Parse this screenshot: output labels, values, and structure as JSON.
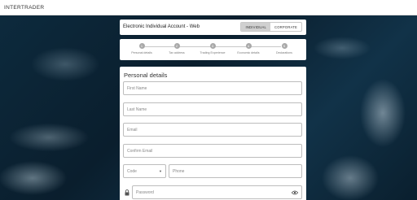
{
  "header": {
    "logo_text": "INTERTRADER"
  },
  "account_card": {
    "title": "Electronic Individual Account - Web",
    "toggle": {
      "individual": "INDIVIDUAL",
      "corporate": "CORPORATE",
      "selected": "INDIVIDUAL"
    }
  },
  "steps": [
    {
      "number": "1",
      "label": "Personal details"
    },
    {
      "number": "2",
      "label": "Tax address"
    },
    {
      "number": "3",
      "label": "Trading Experience"
    },
    {
      "number": "4",
      "label": "Economic details"
    },
    {
      "number": "5",
      "label": "Declarations"
    }
  ],
  "form": {
    "section_title": "Personal details",
    "first_name": {
      "placeholder": "First Name"
    },
    "last_name": {
      "placeholder": "Last Name"
    },
    "email": {
      "placeholder": "Email"
    },
    "confirm_email": {
      "placeholder": "Confirm Email"
    },
    "code": {
      "placeholder": "Code"
    },
    "phone": {
      "placeholder": "Phone"
    },
    "password": {
      "placeholder": "Password"
    }
  },
  "colors": {
    "step_circle": "#a9a9a9",
    "toggle_active": "#d0d0d0",
    "card": "#ffffff",
    "ocean": "#0b2233"
  },
  "icons": {
    "dropdown": "chevron-down-icon",
    "lock": "lock-icon",
    "visibility": "eye-icon"
  }
}
